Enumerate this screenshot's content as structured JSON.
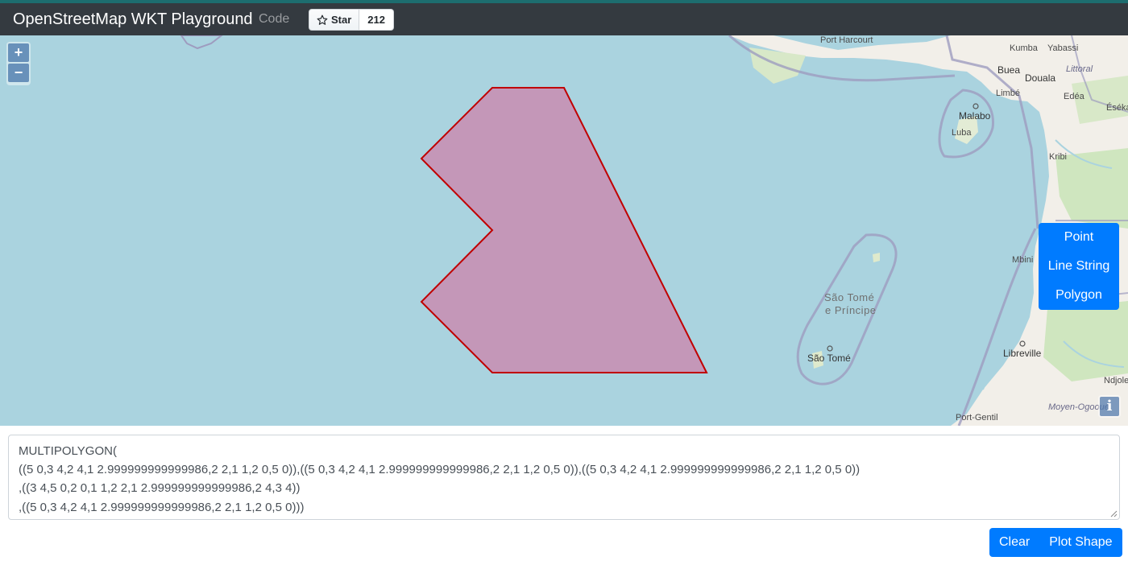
{
  "header": {
    "brand": "OpenStreetMap WKT Playground",
    "code_link": "Code",
    "github": {
      "star_label": "Star",
      "star_count": "212"
    }
  },
  "map": {
    "zoom_in": "+",
    "zoom_out": "−",
    "info": "i",
    "draw_tools": [
      "Point",
      "Line String",
      "Polygon"
    ],
    "place_labels": {
      "port_harcourt": "Port Harcourt",
      "kumba": "Kumba",
      "yabassi": "Yabassi",
      "buea": "Buea",
      "douala": "Douala",
      "littoral": "Littoral",
      "limbe": "Limbé",
      "edea": "Edéa",
      "eseka": "Éséka",
      "malabo": "Malabo",
      "luba": "Luba",
      "kribi": "Kribi",
      "mbini": "Mbini",
      "stp_line1": "São Tomé",
      "stp_line2": "e Príncipe",
      "sao_tome": "São Tomé",
      "libreville": "Libreville",
      "ndjole": "Ndjole",
      "port_gentil": "Port-Gentil",
      "moyen_ogooue": "Moyen-Ogooué"
    },
    "colors": {
      "water": "#aad3df",
      "land": "#f2efe9",
      "polygon_fill": "#c497b8",
      "polygon_stroke": "#c00000",
      "border": "#9e9cbf"
    }
  },
  "wkt_input": {
    "lines": [
      "MULTIPOLYGON(",
      "((5 0,3 4,2 4,1 2.999999999999986,2 2,1 1,2 0,5 0)),((5 0,3 4,2 4,1 2.999999999999986,2 2,1 1,2 0,5 0)),((5 0,3 4,2 4,1 2.999999999999986,2 2,1 1,2 0,5 0))",
      ",((3 4,5 0,2 0,1 1,2 2,1 2.999999999999986,2 4,3 4))",
      ",((5 0,3 4,2 4,1 2.999999999999986,2 2,1 1,2 0,5 0)))"
    ]
  },
  "actions": {
    "clear": "Clear",
    "plot": "Plot Shape"
  }
}
